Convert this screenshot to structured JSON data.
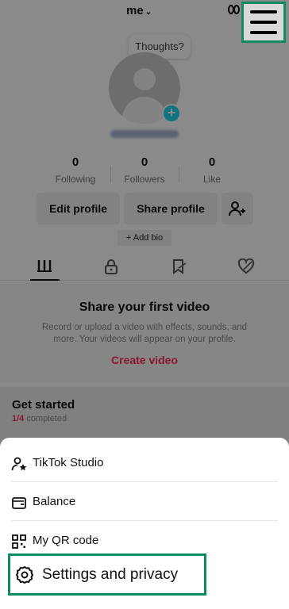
{
  "header": {
    "username": "me",
    "chevron": "⌄",
    "menu_icon": "hamburger-icon"
  },
  "profile": {
    "thoughts_bubble": "Thoughts?",
    "add_photo": "+",
    "stats": [
      {
        "value": "0",
        "label": "Following"
      },
      {
        "value": "0",
        "label": "Followers"
      },
      {
        "value": "0",
        "label": "Like"
      }
    ],
    "edit_profile": "Edit profile",
    "share_profile": "Share profile",
    "add_bio": "+ Add bio"
  },
  "tabs": [
    "videos-grid-icon",
    "lock-icon",
    "tagged-icon",
    "liked-icon"
  ],
  "empty_state": {
    "title": "Share your first video",
    "description": "Record or upload a video with effects, sounds, and more. Your videos will appear on your profile.",
    "cta": "Create video"
  },
  "get_started": {
    "title": "Get started",
    "count": "1/4",
    "suffix": " completed"
  },
  "menu": {
    "items": [
      {
        "label": "TikTok Studio",
        "icon": "studio-icon"
      },
      {
        "label": "Balance",
        "icon": "wallet-icon"
      },
      {
        "label": "My QR code",
        "icon": "qr-code-icon"
      }
    ],
    "settings": {
      "label": "Settings and privacy",
      "icon": "gear-icon"
    }
  },
  "colors": {
    "highlight": "#0f8a64",
    "accent_red": "#fe2c55",
    "plus_badge": "#20d5ec"
  }
}
